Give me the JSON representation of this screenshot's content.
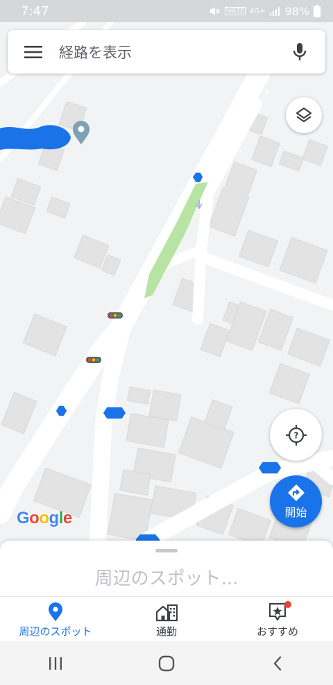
{
  "status_bar": {
    "time": "7:47",
    "network": "4G+",
    "volte": "VoLTE",
    "battery": "98%"
  },
  "search": {
    "placeholder": "経路を表示"
  },
  "map": {
    "logo": [
      "G",
      "o",
      "o",
      "g",
      "l",
      "e"
    ],
    "logo_colors": [
      "#4285f4",
      "#ea4335",
      "#fbbc05",
      "#4285f4",
      "#34a853",
      "#ea4335"
    ]
  },
  "controls": {
    "start_label": "開始"
  },
  "sheet": {
    "title": "周辺のスポット..."
  },
  "bottom_nav": {
    "tabs": [
      {
        "label": "周辺のスポット",
        "icon": "location-pin-icon",
        "active": true
      },
      {
        "label": "通勤",
        "icon": "commute-icon",
        "active": false
      },
      {
        "label": "おすすめ",
        "icon": "for-you-icon",
        "active": false
      }
    ]
  },
  "colors": {
    "accent": "#1a73e8",
    "road": "#ffffff",
    "building": "#e3e3e3",
    "park": "#b7e4a3",
    "notification": "#ea4335"
  }
}
